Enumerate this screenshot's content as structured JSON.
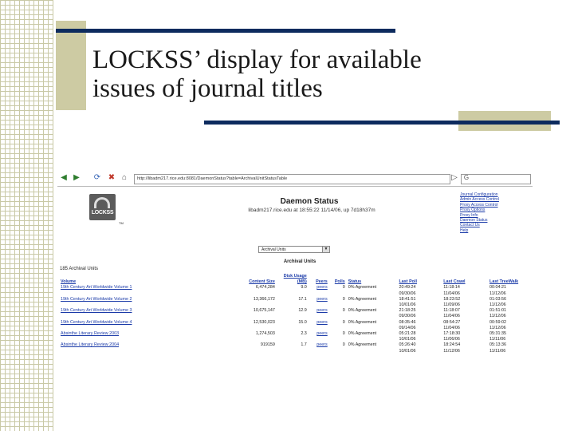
{
  "slide": {
    "title_line1": "LOCKSS’ display for available",
    "title_line2": "issues of journal titles"
  },
  "browser": {
    "url": "http://libadm217.rice.edu:8081/DaemonStatus?table=ArchivalUnitStatusTable"
  },
  "header": {
    "logo_text": "LOCKSS",
    "logo_tm": "TM",
    "title": "Daemon Status",
    "subtitle": "libadm217.rice.edu at 18:55:22 11/14/06, up 7d18h37m"
  },
  "side_links": [
    "Journal Configuration",
    "Admin Access Control",
    "Proxy Access Control",
    "Proxy Options",
    "Proxy Info",
    "Daemon Status",
    "Contact Us",
    "Help"
  ],
  "table_select": {
    "value": "Archival Units"
  },
  "table_caption": "Archival Units",
  "unit_count": "185 Archival Units",
  "columns": {
    "volume": "Volume",
    "content_size": "Content Size",
    "disk_usage_line1": "Disk Usage",
    "disk_usage_line2": "(MB)",
    "peers": "Peers",
    "polls": "Polls",
    "status": "Status",
    "last_poll": "Last Poll",
    "last_crawl": "Last Crawl",
    "last_treewalk": "Last TreeWalk"
  },
  "rows": [
    {
      "volume": "19th Century Art Worldwide Volume 1",
      "size": "6,474,284",
      "disk": "9.0",
      "peers": "peers",
      "polls": "0",
      "status": "0% Agreement",
      "poll_time": "20:49:24",
      "poll_date": "09/30/06",
      "crawl_time": "11:18:14",
      "crawl_date": "11/04/06",
      "tree_time": "00:04:21",
      "tree_date": "11/12/06"
    },
    {
      "volume": "19th Century Art Worldwide Volume 2",
      "size": "13,366,172",
      "disk": "17.1",
      "peers": "peers",
      "polls": "0",
      "status": "0% Agreement",
      "poll_time": "18:41:51",
      "poll_date": "10/01/06",
      "crawl_time": "18:23:52",
      "crawl_date": "11/09/06",
      "tree_time": "01:03:56",
      "tree_date": "11/12/06"
    },
    {
      "volume": "19th Century Art Worldwide Volume 3",
      "size": "10,675,147",
      "disk": "12.9",
      "peers": "peers",
      "polls": "0",
      "status": "0% Agreement",
      "poll_time": "21:18:25",
      "poll_date": "09/30/06",
      "crawl_time": "11:18:07",
      "crawl_date": "11/04/06",
      "tree_time": "01:51:01",
      "tree_date": "11/12/06"
    },
    {
      "volume": "19th Century Art Worldwide Volume 4",
      "size": "12,530,023",
      "disk": "15.0",
      "peers": "peers",
      "polls": "0",
      "status": "0% Agreement",
      "poll_time": "08:35:46",
      "poll_date": "09/14/06",
      "crawl_time": "08:54:27",
      "crawl_date": "11/04/06",
      "tree_time": "00:59:02",
      "tree_date": "11/12/06"
    },
    {
      "volume": "Absinthe Literary Review 2003",
      "size": "1,274,503",
      "disk": "2.3",
      "peers": "peers",
      "polls": "0",
      "status": "0% Agreement",
      "poll_time": "05:21:28",
      "poll_date": "10/01/06",
      "crawl_time": "17:18:30",
      "crawl_date": "11/06/06",
      "tree_time": "05:31:35",
      "tree_date": "11/11/06"
    },
    {
      "volume": "Absinthe Literary Review 2004",
      "size": "919159",
      "disk": "1.7",
      "peers": "peers",
      "polls": "0",
      "status": "0% Agreement",
      "poll_time": "05:26:40",
      "poll_date": "10/01/06",
      "crawl_time": "18:24:54",
      "crawl_date": "11/12/06",
      "tree_time": "05:13:36",
      "tree_date": "11/11/06"
    }
  ]
}
